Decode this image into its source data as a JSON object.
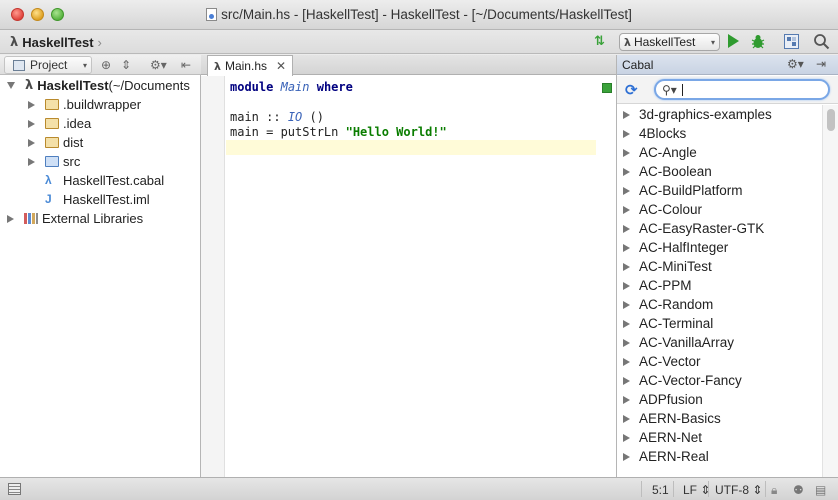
{
  "window": {
    "title": "src/Main.hs - [HaskellTest] - HaskellTest - [~/Documents/HaskellTest]"
  },
  "navbar": {
    "breadcrumb": "HaskellTest",
    "run_config": "HaskellTest"
  },
  "project_panel": {
    "tab_label": "Project",
    "tree": [
      {
        "label": "HaskellTest",
        "suffix": " (~/Documents",
        "icon": "haskell-module-icon",
        "expanded": true
      },
      {
        "label": ".buildwrapper",
        "icon": "folder-icon"
      },
      {
        "label": ".idea",
        "icon": "folder-icon"
      },
      {
        "label": "dist",
        "icon": "folder-icon"
      },
      {
        "label": "src",
        "icon": "source-folder-icon"
      },
      {
        "label": "HaskellTest.cabal",
        "icon": "cabal-file-icon"
      },
      {
        "label": "HaskellTest.iml",
        "icon": "iml-file-icon"
      },
      {
        "label": "External Libraries",
        "icon": "libraries-icon"
      }
    ]
  },
  "editor": {
    "tab_label": "Main.hs",
    "code": {
      "line1": {
        "kw1": "module",
        "name": "Main",
        "kw2": "where"
      },
      "line3": {
        "name": "main",
        "op": " :: ",
        "type": "IO",
        "rest": " ()"
      },
      "line4": {
        "prefix": "main = putStrLn ",
        "string": "\"Hello World!\""
      }
    }
  },
  "cabal_panel": {
    "title": "Cabal",
    "search_value": "",
    "packages": [
      "3d-graphics-examples",
      "4Blocks",
      "AC-Angle",
      "AC-Boolean",
      "AC-BuildPlatform",
      "AC-Colour",
      "AC-EasyRaster-GTK",
      "AC-HalfInteger",
      "AC-MiniTest",
      "AC-PPM",
      "AC-Random",
      "AC-Terminal",
      "AC-VanillaArray",
      "AC-Vector",
      "AC-Vector-Fancy",
      "ADPfusion",
      "AERN-Basics",
      "AERN-Net",
      "AERN-Real"
    ]
  },
  "statusbar": {
    "position": "5:1",
    "line_separator": "LF",
    "encoding": "UTF-8"
  },
  "colors": {
    "accent": "#2d6fd4",
    "run_green": "#2f9b2f",
    "string_green": "#0a7d00",
    "keyword_navy": "#000080"
  }
}
